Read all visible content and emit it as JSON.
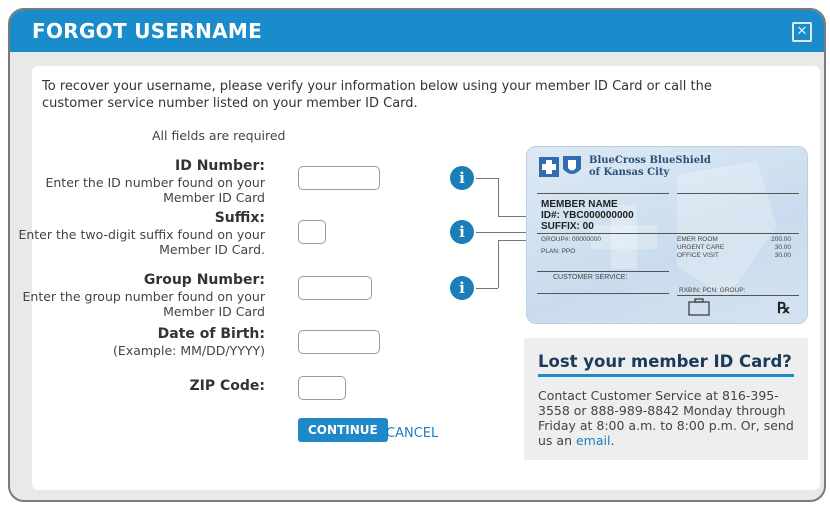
{
  "dialog": {
    "title": "FORGOT USERNAME",
    "close_icon": "close-icon"
  },
  "intro": "To recover your username, please verify your information below using your member ID Card or call the customer service number listed on your member ID Card.",
  "required_note": "All fields are required",
  "fields": {
    "id_number": {
      "label": "ID Number:",
      "help": [
        "Enter the ID number found on your",
        "Member ID Card"
      ],
      "value": ""
    },
    "suffix": {
      "label": "Suffix:",
      "help": [
        "Enter the two-digit suffix found on your",
        "Member ID Card."
      ],
      "value": ""
    },
    "group_number": {
      "label": "Group Number:",
      "help": [
        "Enter the group number found on your",
        "Member ID Card"
      ],
      "value": ""
    },
    "dob": {
      "label": "Date of Birth:",
      "help": [
        "(Example: MM/DD/YYYY)"
      ],
      "value": ""
    },
    "zip": {
      "label": "ZIP Code:",
      "value": ""
    }
  },
  "buttons": {
    "continue": "CONTINUE",
    "cancel": "CANCEL"
  },
  "card": {
    "brand_line1": "BlueCross BlueShield",
    "brand_line2": "of Kansas City",
    "member_name": "MEMBER NAME",
    "id": "ID#:  YBC000000000",
    "suffix": "SUFFIX:  00",
    "group": "GROUP#: 00000000",
    "plan": "PLAN:  PPO",
    "customer_service": "CUSTOMER SERVICE:",
    "copays": [
      {
        "label": "EMER ROOM",
        "amount": "200.00"
      },
      {
        "label": "URGENT CARE",
        "amount": "30.00"
      },
      {
        "label": "OFFICE VISIT",
        "amount": "30.00"
      }
    ],
    "rx_codes": "RXBIN:       PCN:   GROUP:",
    "rx_symbol": "℞"
  },
  "lost_card": {
    "heading": "Lost your member ID Card?",
    "text": "Contact Customer Service at 816-395-3558 or 888-989-8842 Monday through Friday at 8:00 a.m. to 8:00 p.m. Or, send us an",
    "link": "email",
    "end": "."
  },
  "colors": {
    "header": "#1a8ccc",
    "accent": "#1e7fc0",
    "heading": "#1b3b5c"
  }
}
